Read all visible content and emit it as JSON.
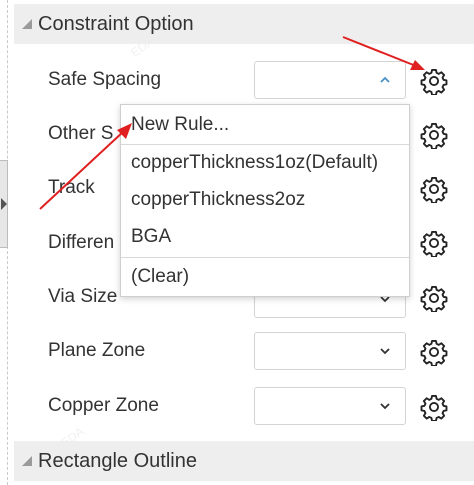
{
  "sections": {
    "constraint_title": "Constraint Option",
    "rectangle_title": "Rectangle Outline"
  },
  "rows": [
    {
      "label": "Safe Spacing",
      "open": true
    },
    {
      "label": "Other S"
    },
    {
      "label": "Track"
    },
    {
      "label": "Differen"
    },
    {
      "label": "Via Size"
    },
    {
      "label": "Plane Zone"
    },
    {
      "label": "Copper Zone"
    }
  ],
  "dropdown": {
    "items": [
      "New Rule...",
      "copperThickness1oz(Default)",
      "copperThickness2oz",
      "BGA",
      "(Clear)"
    ]
  },
  "icons": {
    "gear": "gear-icon",
    "chevron_down": "chevron-down-icon",
    "chevron_up": "chevron-up-icon",
    "collapse": "collapse-triangle-icon"
  },
  "colors": {
    "annotation_arrow": "#e02020",
    "header_bg": "#eeeeee",
    "chevron_open": "#4a90c8"
  }
}
